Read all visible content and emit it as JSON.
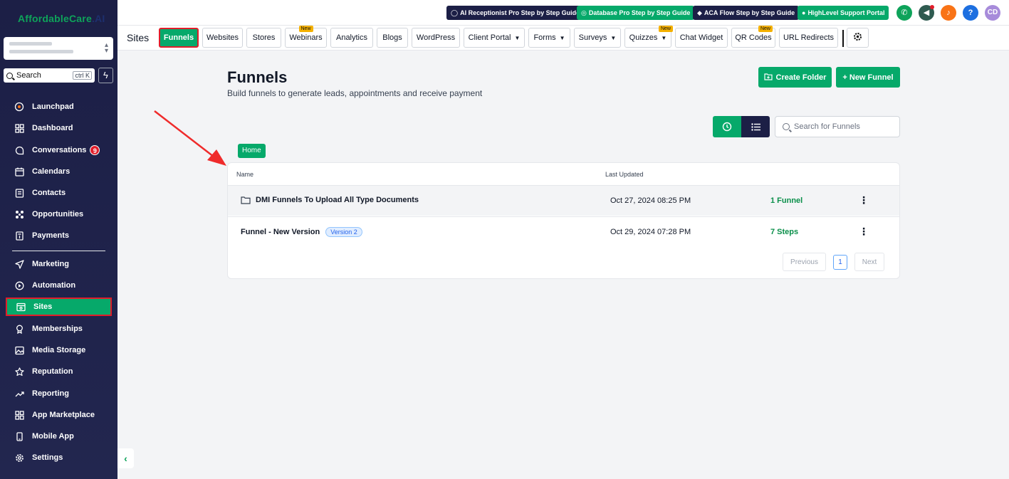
{
  "brand": {
    "logo_main": "AffordableCare",
    "logo_suffix": ".AI"
  },
  "sidebar": {
    "search_placeholder": "Search",
    "search_shortcut": "ctrl K",
    "items": [
      {
        "label": "Launchpad",
        "icon": "rocket-icon"
      },
      {
        "label": "Dashboard",
        "icon": "grid-icon"
      },
      {
        "label": "Conversations",
        "icon": "chat-icon",
        "badge": "9"
      },
      {
        "label": "Calendars",
        "icon": "calendar-icon"
      },
      {
        "label": "Contacts",
        "icon": "contacts-icon"
      },
      {
        "label": "Opportunities",
        "icon": "opportunities-icon"
      },
      {
        "label": "Payments",
        "icon": "payments-icon"
      },
      {
        "label": "Marketing",
        "icon": "send-icon"
      },
      {
        "label": "Automation",
        "icon": "automation-icon"
      },
      {
        "label": "Sites",
        "icon": "sites-icon",
        "active": true
      },
      {
        "label": "Memberships",
        "icon": "award-icon"
      },
      {
        "label": "Media Storage",
        "icon": "image-icon"
      },
      {
        "label": "Reputation",
        "icon": "star-icon"
      },
      {
        "label": "Reporting",
        "icon": "trend-icon"
      },
      {
        "label": "App Marketplace",
        "icon": "apps-icon"
      },
      {
        "label": "Mobile App",
        "icon": "mobile-icon"
      },
      {
        "label": "Settings",
        "icon": "gear-icon"
      }
    ]
  },
  "topbar": {
    "guides": [
      {
        "label": "AI Receptionist Pro Step by Step Guide",
        "color": "#1c1f46"
      },
      {
        "label": "Database Pro Step by Step Guide",
        "color": "#06a96a"
      },
      {
        "label": "ACA Flow Step by Step Guide",
        "color": "#1c1f46"
      },
      {
        "label": "HighLevel Support Portal",
        "color": "#06a96a"
      }
    ],
    "avatar_initials": "CD",
    "help_label": "?"
  },
  "tabs": {
    "section": "Sites",
    "items": [
      {
        "label": "Funnels",
        "active": true
      },
      {
        "label": "Websites"
      },
      {
        "label": "Stores"
      },
      {
        "label": "Webinars",
        "new": "New"
      },
      {
        "label": "Analytics"
      },
      {
        "label": "Blogs"
      },
      {
        "label": "WordPress"
      },
      {
        "label": "Client Portal",
        "dropdown": true
      },
      {
        "label": "Forms",
        "dropdown": true
      },
      {
        "label": "Surveys",
        "dropdown": true
      },
      {
        "label": "Quizzes",
        "dropdown": true,
        "new": "New"
      },
      {
        "label": "Chat Widget"
      },
      {
        "label": "QR Codes",
        "new": "New"
      },
      {
        "label": "URL Redirects"
      }
    ]
  },
  "main": {
    "title": "Funnels",
    "subtitle": "Build funnels to generate leads, appointments and receive payment",
    "create_folder": "Create Folder",
    "new_funnel": "+ New Funnel",
    "search_placeholder": "Search for Funnels",
    "breadcrumb": "Home",
    "columns": {
      "name": "Name",
      "updated": "Last Updated"
    },
    "rows": [
      {
        "name": "DMI Funnels To Upload All Type Documents",
        "updated": "Oct 27, 2024 08:25 PM",
        "count": "1 Funnel",
        "type": "folder"
      },
      {
        "name": "Funnel - New Version",
        "badge": "Version 2",
        "updated": "Oct 29, 2024 07:28 PM",
        "count": "7 Steps",
        "type": "funnel"
      }
    ],
    "pagination": {
      "prev": "Previous",
      "current": "1",
      "next": "Next"
    }
  },
  "colors": {
    "accent": "#06a96a",
    "navy": "#1c1f46",
    "highlight": "#e11d2a"
  }
}
